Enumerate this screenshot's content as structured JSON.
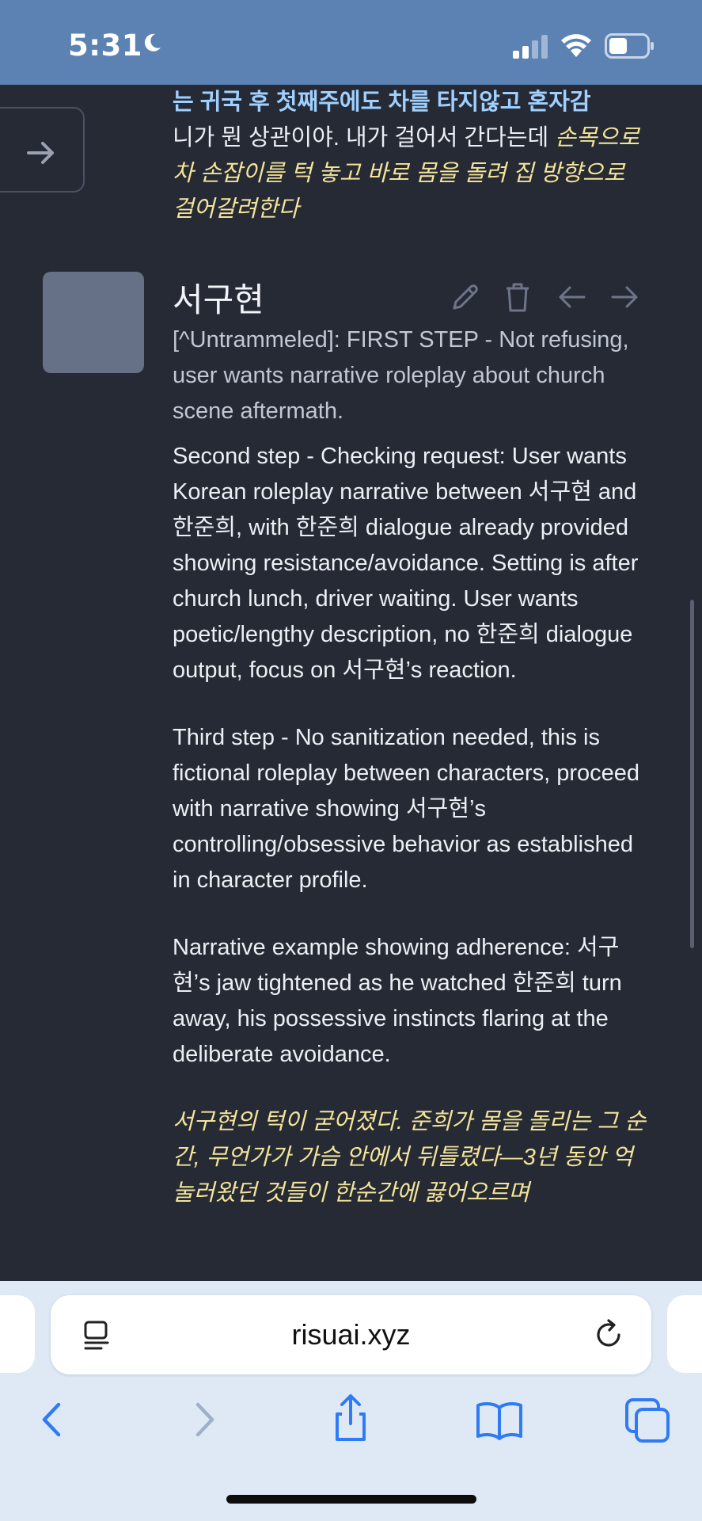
{
  "status_bar": {
    "time": "5:31"
  },
  "previous_message": {
    "line1_bold": "는 귀국 후 첫째주에도 차를 타지않고 혼자감",
    "line2_plain": "니가 뭔 상관이야. 내가 걸어서 간다는데 ",
    "line2_italic": "손목으로 차 손잡이를 턱 놓고 바로 몸을 돌려 집 방향으로 걸어갈려한다"
  },
  "message": {
    "character_name": "서구현",
    "reasoning_header": "[^Untrammeled]: FIRST STEP - Not refusing, user wants narrative roleplay about church scene aftermath.",
    "paragraph_2": "Second step - Checking request: User wants Korean roleplay narrative between 서구현 and 한준희, with 한준희 dialogue already provided showing resistance/avoidance. Setting is after church lunch, driver waiting. User wants poetic/lengthy description, no 한준희 dialogue output, focus on 서구현’s reaction.",
    "paragraph_3": "Third step - No sanitization needed, this is fictional roleplay between characters, proceed with narrative showing 서구현’s controlling/obsessive behavior as established in character profile.",
    "paragraph_4": "Narrative example showing adherence: 서구현’s jaw tightened as he watched 한준희 turn away, his possessive instincts flaring at the deliberate avoidance.",
    "paragraph_5_italic": "서구현의 턱이 굳어졌다. 준희가 몸을 돌리는 그 순간, 무언가가 가슴 안에서 뒤틀렸다—3년 동안 억눌러왔던 것들이 한순간에 끓어오르며"
  },
  "message_actions": [
    "edit-icon",
    "trash-icon",
    "arrow-left-icon",
    "arrow-right-icon"
  ],
  "browser": {
    "url": "risuai.xyz",
    "nav": [
      "back-icon",
      "forward-icon",
      "share-icon",
      "bookmarks-icon",
      "tabs-icon"
    ]
  },
  "colors": {
    "status_bar": "#5b82b3",
    "background": "#262a35",
    "bold_text": "#9fd0ff",
    "italic_text": "#f3e49a",
    "browser_bar": "#dfe9f6",
    "accent": "#2f7bf6"
  }
}
